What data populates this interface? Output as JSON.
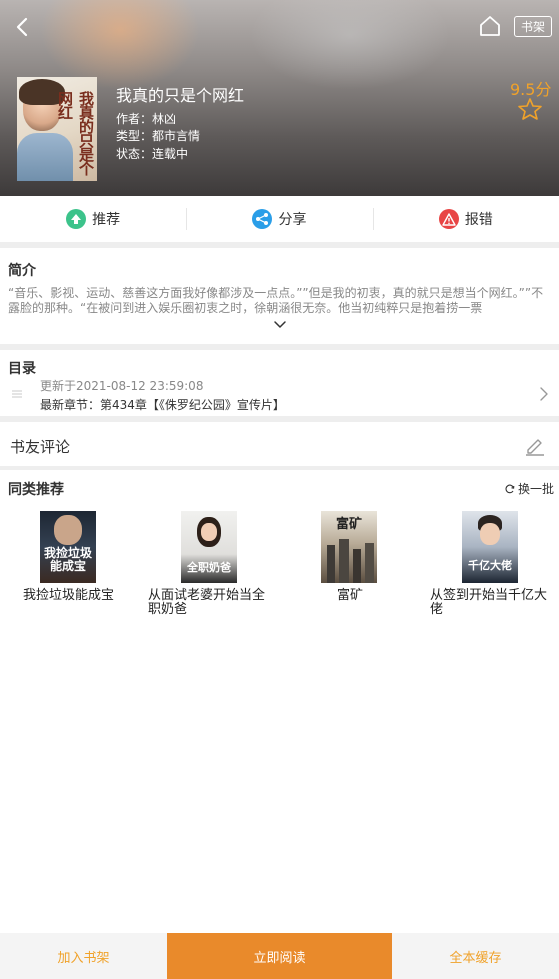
{
  "header": {
    "shelf_label": "书架",
    "cover_text": "我真的只是个网红"
  },
  "book": {
    "title": "我真的只是个网红",
    "author": "作者：林凶",
    "type": "类型：都市言情",
    "status": "状态：连载中",
    "score": "9.5分"
  },
  "actions": {
    "recommend": "推荐",
    "share": "分享",
    "report": "报错"
  },
  "intro": {
    "title": "简介",
    "text": "“音乐、影视、运动、慈善这方面我好像都涉及一点点。””但是我的初衷，真的就只是想当个网红。””不露脸的那种。“在被问到进入娱乐圈初衷之时，徐朝涵很无奈。他当初纯粹只是抱着捞一票"
  },
  "toc": {
    "title": "目录",
    "updated": "更新于2021-08-12 23:59:08",
    "latest": "最新章节：第434章【《侏罗纪公园》宣传片】"
  },
  "comments": {
    "title": "书友评论"
  },
  "recs": {
    "title": "同类推荐",
    "refresh": "换一批",
    "items": [
      {
        "name": "我捡垃圾能成宝",
        "cover_text": "我捡垃圾能成宝"
      },
      {
        "name": "从面试老婆开始当全职奶爸",
        "cover_text": "全职奶爸"
      },
      {
        "name": "富矿",
        "cover_text": "富矿"
      },
      {
        "name": "从签到开始当千亿大佬",
        "cover_text": "千亿大佬"
      }
    ]
  },
  "bottom": {
    "add_shelf": "加入书架",
    "read_now": "立即阅读",
    "cache_all": "全本缓存"
  },
  "colors": {
    "accent": "#e98a2b",
    "score": "#f0a22a",
    "recommend_icon": "#3cc38b",
    "share_icon": "#2a9ee8",
    "report_icon": "#e84545"
  }
}
